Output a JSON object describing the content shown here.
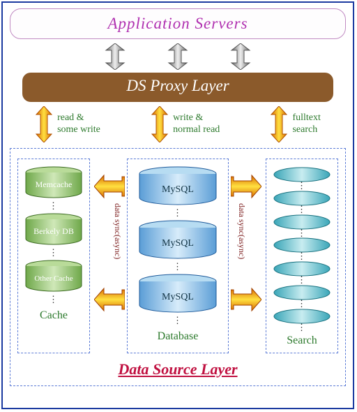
{
  "app_servers": {
    "title": "Application  Servers"
  },
  "proxy": {
    "title": "DS Proxy Layer"
  },
  "flows": {
    "left": {
      "line1": "read &",
      "line2": "some write"
    },
    "mid": {
      "line1": "write &",
      "line2": "normal read"
    },
    "right": {
      "line1": "fulltext",
      "line2": "search"
    }
  },
  "sync": {
    "left": "data sync(async)",
    "right": "data sync(async)"
  },
  "cache": {
    "title": "Cache",
    "items": [
      "Memcache",
      "Berkely DB",
      "Other Cache"
    ]
  },
  "database": {
    "title": "Database",
    "items": [
      "MySQL",
      "MySQL",
      "MySQL"
    ]
  },
  "search": {
    "title": "Search",
    "ellipse_count": 7
  },
  "dsl": {
    "title": "Data Source Layer"
  }
}
